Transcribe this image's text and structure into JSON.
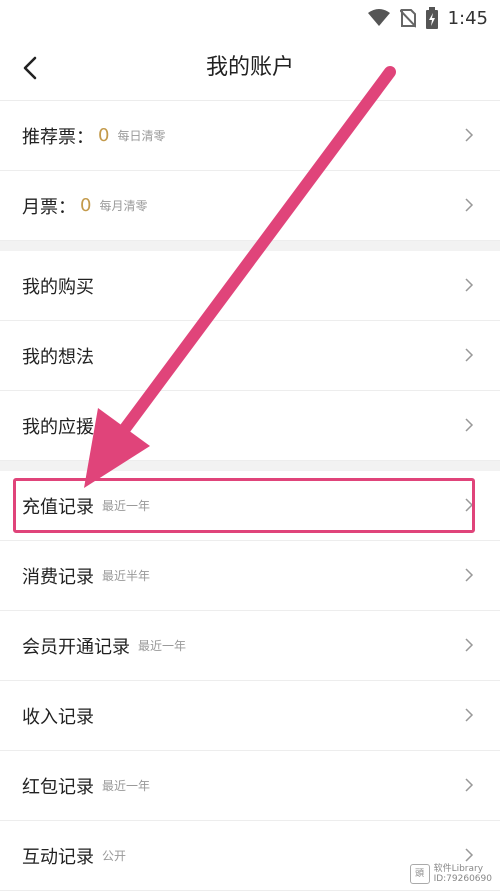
{
  "status_bar": {
    "time": "1:45",
    "icons": [
      "wifi-icon",
      "no-sim-icon",
      "battery-charging-icon"
    ]
  },
  "header": {
    "title": "我的账户",
    "back_icon": "chevron-left-icon"
  },
  "sections": [
    {
      "rows": [
        {
          "label": "推荐票：",
          "value": "0",
          "sub": "每日清零"
        },
        {
          "label": "月票：",
          "value": "0",
          "sub": "每月清零"
        }
      ]
    },
    {
      "rows": [
        {
          "label": "我的购买"
        },
        {
          "label": "我的想法"
        },
        {
          "label": "我的应援"
        }
      ]
    },
    {
      "rows": [
        {
          "label": "充值记录",
          "sub": "最近一年"
        },
        {
          "label": "消费记录",
          "sub": "最近半年"
        },
        {
          "label": "会员开通记录",
          "sub": "最近一年"
        },
        {
          "label": "收入记录"
        },
        {
          "label": "红包记录",
          "sub": "最近一年"
        },
        {
          "label": "互动记录",
          "sub": "公开"
        }
      ]
    }
  ],
  "annotation": {
    "color": "#e0447a",
    "highlighted_row": "充值记录"
  },
  "watermark": {
    "line1": "软件Library",
    "line2": "ID:79260690"
  },
  "colors": {
    "value_gold": "#c39a4b",
    "section_gap": "#f2f2f2"
  }
}
